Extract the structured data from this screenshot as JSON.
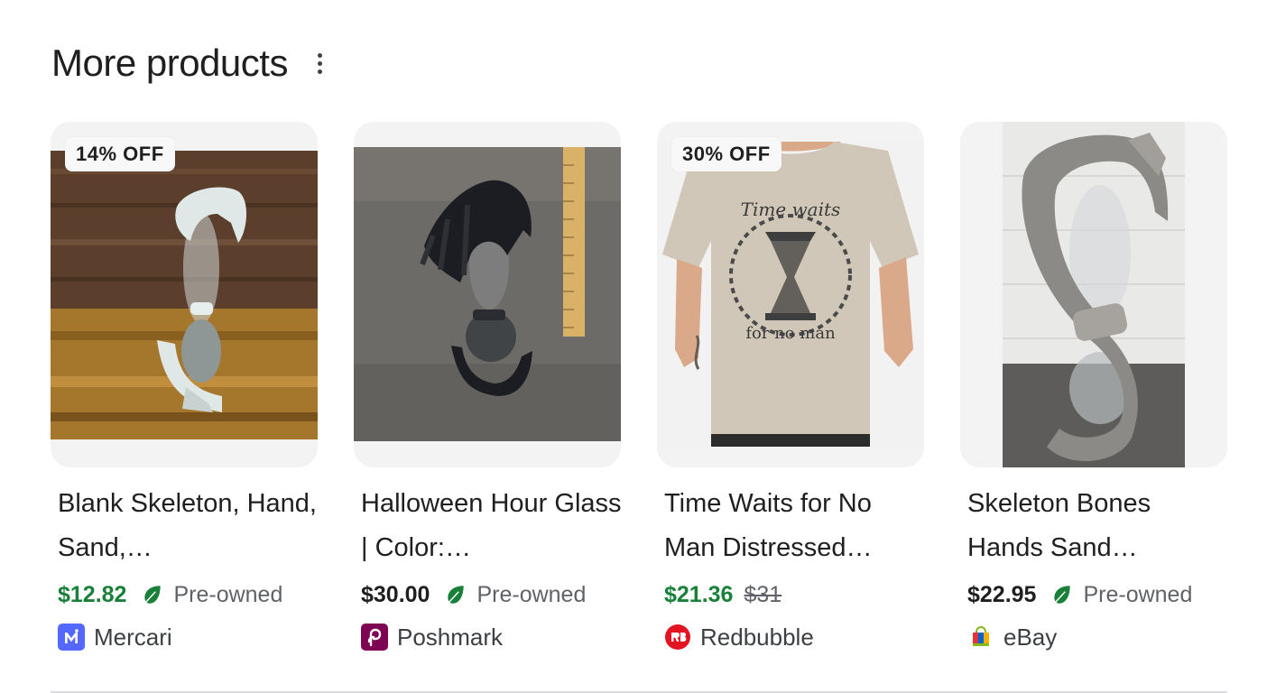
{
  "section": {
    "title": "More products"
  },
  "icons": {
    "more_menu": "vertical-ellipsis-icon",
    "leaf": "leaf-icon"
  },
  "colors": {
    "sale_price": "#188038",
    "leaf": "#188038",
    "mercari": "#5468ff",
    "poshmark": "#7f0353",
    "redbubble": "#e41321"
  },
  "products": [
    {
      "badge": "14% OFF",
      "title": "Blank Skeleton, Hand, Sand,…",
      "price": "$12.82",
      "price_style": "sale",
      "condition": "Pre-owned",
      "old_price": "",
      "seller": "Mercari",
      "seller_icon": "mercari-logo-icon",
      "image": "bone-white skeleton hand hourglass on wood"
    },
    {
      "badge": "",
      "title": "Halloween Hour Glass | Color:…",
      "price": "$30.00",
      "price_style": "regular",
      "condition": "Pre-owned",
      "old_price": "",
      "seller": "Poshmark",
      "seller_icon": "poshmark-logo-icon",
      "image": "black skeleton hand hourglass with ruler"
    },
    {
      "badge": "30% OFF",
      "title": "Time Waits for No Man Distressed…",
      "price": "$21.36",
      "price_style": "sale",
      "condition": "",
      "old_price": "$31",
      "seller": "Redbubble",
      "seller_icon": "redbubble-logo-icon",
      "image": "tan t-shirt with hourglass print"
    },
    {
      "badge": "",
      "title": "Skeleton Bones Hands Sand…",
      "price": "$22.95",
      "price_style": "regular",
      "condition": "Pre-owned",
      "old_price": "",
      "seller": "eBay",
      "seller_icon": "ebay-bag-icon",
      "image": "silver skeleton hands hourglass"
    }
  ]
}
